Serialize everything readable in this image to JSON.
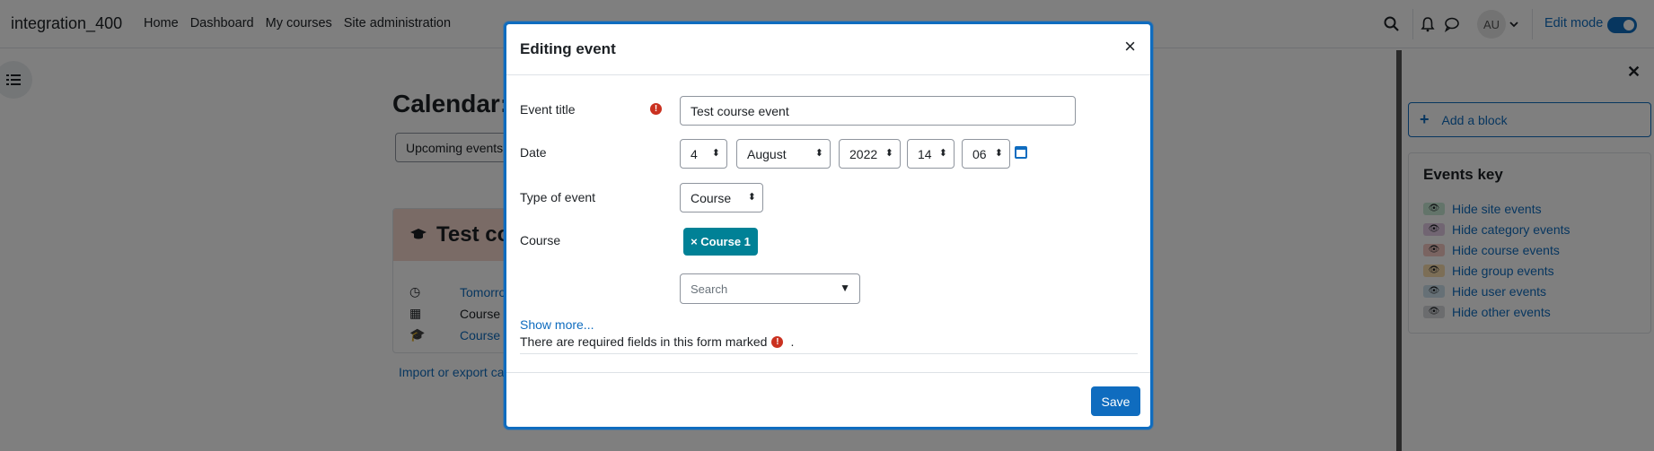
{
  "navbar": {
    "brand": "integration_400",
    "links": [
      "Home",
      "Dashboard",
      "My courses",
      "Site administration"
    ],
    "avatar_initials": "AU",
    "edit_mode_label": "Edit mode"
  },
  "main": {
    "page_title": "Calendar:",
    "view_select": "Upcoming events",
    "event_title_partial": "Test co",
    "event_rows": [
      "Tomorro",
      "Course e",
      "Course 1"
    ],
    "import_link": "Import or export cal"
  },
  "drawer": {
    "add_block_label": "Add a block",
    "events_key_title": "Events key",
    "key_items": [
      {
        "label": "Hide site events",
        "color": "#c7e9d5"
      },
      {
        "label": "Hide category events",
        "color": "#e3cbe4"
      },
      {
        "label": "Hide course events",
        "color": "#f4c9c2"
      },
      {
        "label": "Hide group events",
        "color": "#f8dcad"
      },
      {
        "label": "Hide user events",
        "color": "#cde0ec"
      },
      {
        "label": "Hide other events",
        "color": "#d6d9dc"
      }
    ]
  },
  "modal": {
    "title": "Editing event",
    "close_glyph": "×",
    "fields": {
      "event_title_label": "Event title",
      "event_title_value": "Test course event",
      "date_label": "Date",
      "date_day": "4",
      "date_month": "August",
      "date_year": "2022",
      "date_hour": "14",
      "date_minute": "06",
      "type_label": "Type of event",
      "type_value": "Course",
      "course_label": "Course",
      "course_chip": "× Course 1",
      "search_placeholder": "Search",
      "search_caret": "▼"
    },
    "show_more": "Show more...",
    "required_note": "There are required fields in this form marked",
    "required_note_end": ".",
    "save_label": "Save"
  },
  "colors": {
    "primary": "#0f6cbf",
    "required": "#ca3120",
    "chip": "#008196"
  }
}
